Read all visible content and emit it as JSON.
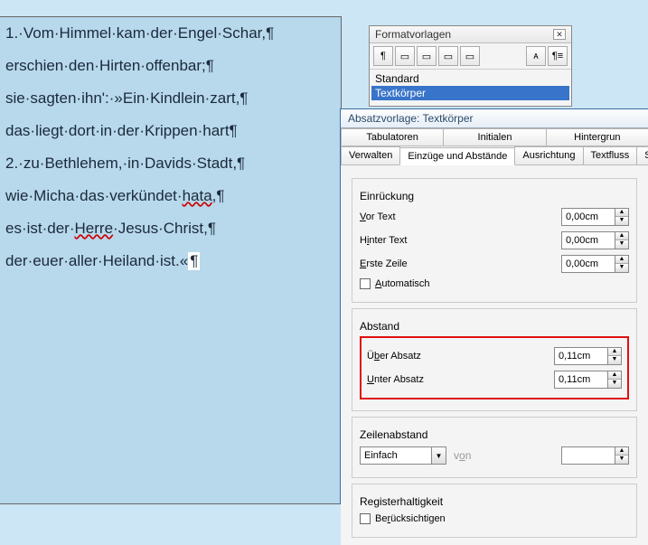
{
  "document": {
    "lines": [
      "1.·Vom·Himmel·kam·der·Engel·Schar,¶",
      "erschien·den·Hirten·offenbar;¶",
      "sie·sagten·ihn':·»Ein·Kindlein·zart,¶",
      "das·liegt·dort·in·der·Krippen·hart¶",
      "2.·zu·Bethlehem,·in·Davids·Stadt,¶",
      "wie·Micha·das·verkündet·",
      "hata",
      ",¶",
      "es·ist·der·",
      "Herre",
      "·Jesus·Christ,¶",
      "der·euer·aller·Heiland·ist.«",
      "¶"
    ]
  },
  "styles_panel": {
    "title": "Formatvorlagen",
    "items": [
      "Standard",
      "Textkörper"
    ],
    "icons": [
      "¶",
      "▭",
      "▭",
      "▭",
      "▭",
      "ᴀ",
      "¶≡"
    ]
  },
  "dialog": {
    "title": "Absatzvorlage: Textkörper",
    "tabs_top": [
      "Tabulatoren",
      "Initialen",
      "Hintergrun"
    ],
    "tabs_bottom": [
      "Verwalten",
      "Einzüge und Abstände",
      "Ausrichtung",
      "Textfluss",
      "Sch"
    ],
    "active_tab": "Einzüge und Abstände",
    "groups": {
      "einrueckung": {
        "label": "Einrückung",
        "vor_text_label": "Vor Text",
        "vor_text_value": "0,00cm",
        "hinter_text_label": "Hinter Text",
        "hinter_text_value": "0,00cm",
        "erste_zeile_label": "Erste Zeile",
        "erste_zeile_value": "0,00cm",
        "automatisch_label": "Automatisch"
      },
      "abstand": {
        "label": "Abstand",
        "ueber_label": "Über Absatz",
        "ueber_value": "0,11cm",
        "unter_label": "Unter Absatz",
        "unter_value": "0,11cm"
      },
      "zeilenabstand": {
        "label": "Zeilenabstand",
        "combo_value": "Einfach",
        "von_label": "von",
        "von_value": ""
      },
      "register": {
        "label": "Registerhaltigkeit",
        "check_label": "Berücksichtigen"
      }
    }
  }
}
